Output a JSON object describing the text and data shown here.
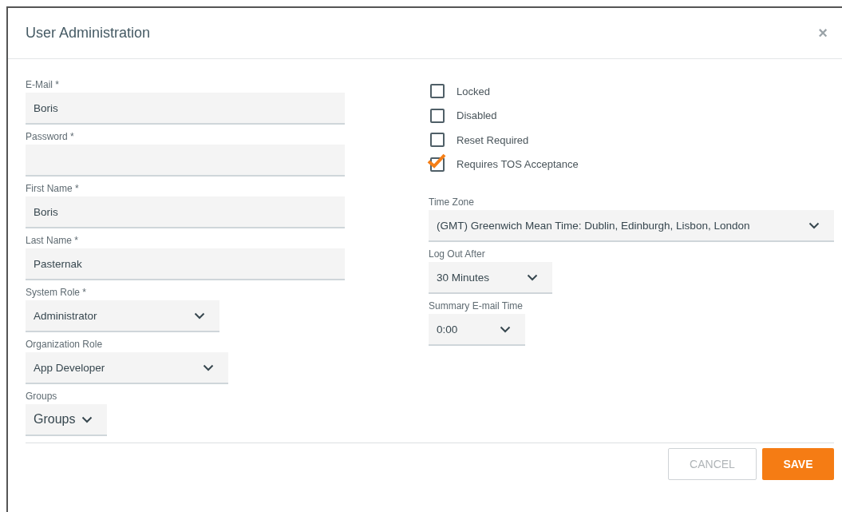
{
  "dialog": {
    "title": "User Administration",
    "close": "×"
  },
  "left_fields": [
    {
      "kind": "text",
      "label": "E-Mail *",
      "value": "Boris"
    },
    {
      "kind": "text",
      "label": "Password *"
    },
    {
      "kind": "text",
      "label": "First Name *",
      "value": "Boris"
    },
    {
      "kind": "text",
      "label": "Last Name *",
      "value": "Pasternak"
    },
    {
      "kind": "select",
      "label": "System Role *",
      "value": "Administrator"
    },
    {
      "kind": "select",
      "label": "Organization Role",
      "value": "App Developer"
    },
    {
      "kind": "select",
      "label": "Groups",
      "value": "Groups"
    }
  ],
  "checkboxes": [
    {
      "label": "Locked",
      "checked": false
    },
    {
      "label": "Disabled",
      "checked": false
    },
    {
      "label": "Reset Required",
      "checked": false
    },
    {
      "label": "Requires TOS Acceptance",
      "checked": true
    }
  ],
  "right_fields": [
    {
      "kind": "select",
      "label": "Time Zone",
      "value": "(GMT) Greenwich Mean Time: Dublin, Edinburgh, Lisbon, London"
    },
    {
      "kind": "select",
      "label": "Log Out After",
      "value": "30 Minutes"
    },
    {
      "kind": "select",
      "label": "Summary E-mail Time",
      "value": "0:00"
    }
  ],
  "buttons": [
    {
      "kind": "secondary",
      "label": "CANCEL"
    },
    {
      "kind": "primary",
      "label": "SAVE"
    }
  ]
}
